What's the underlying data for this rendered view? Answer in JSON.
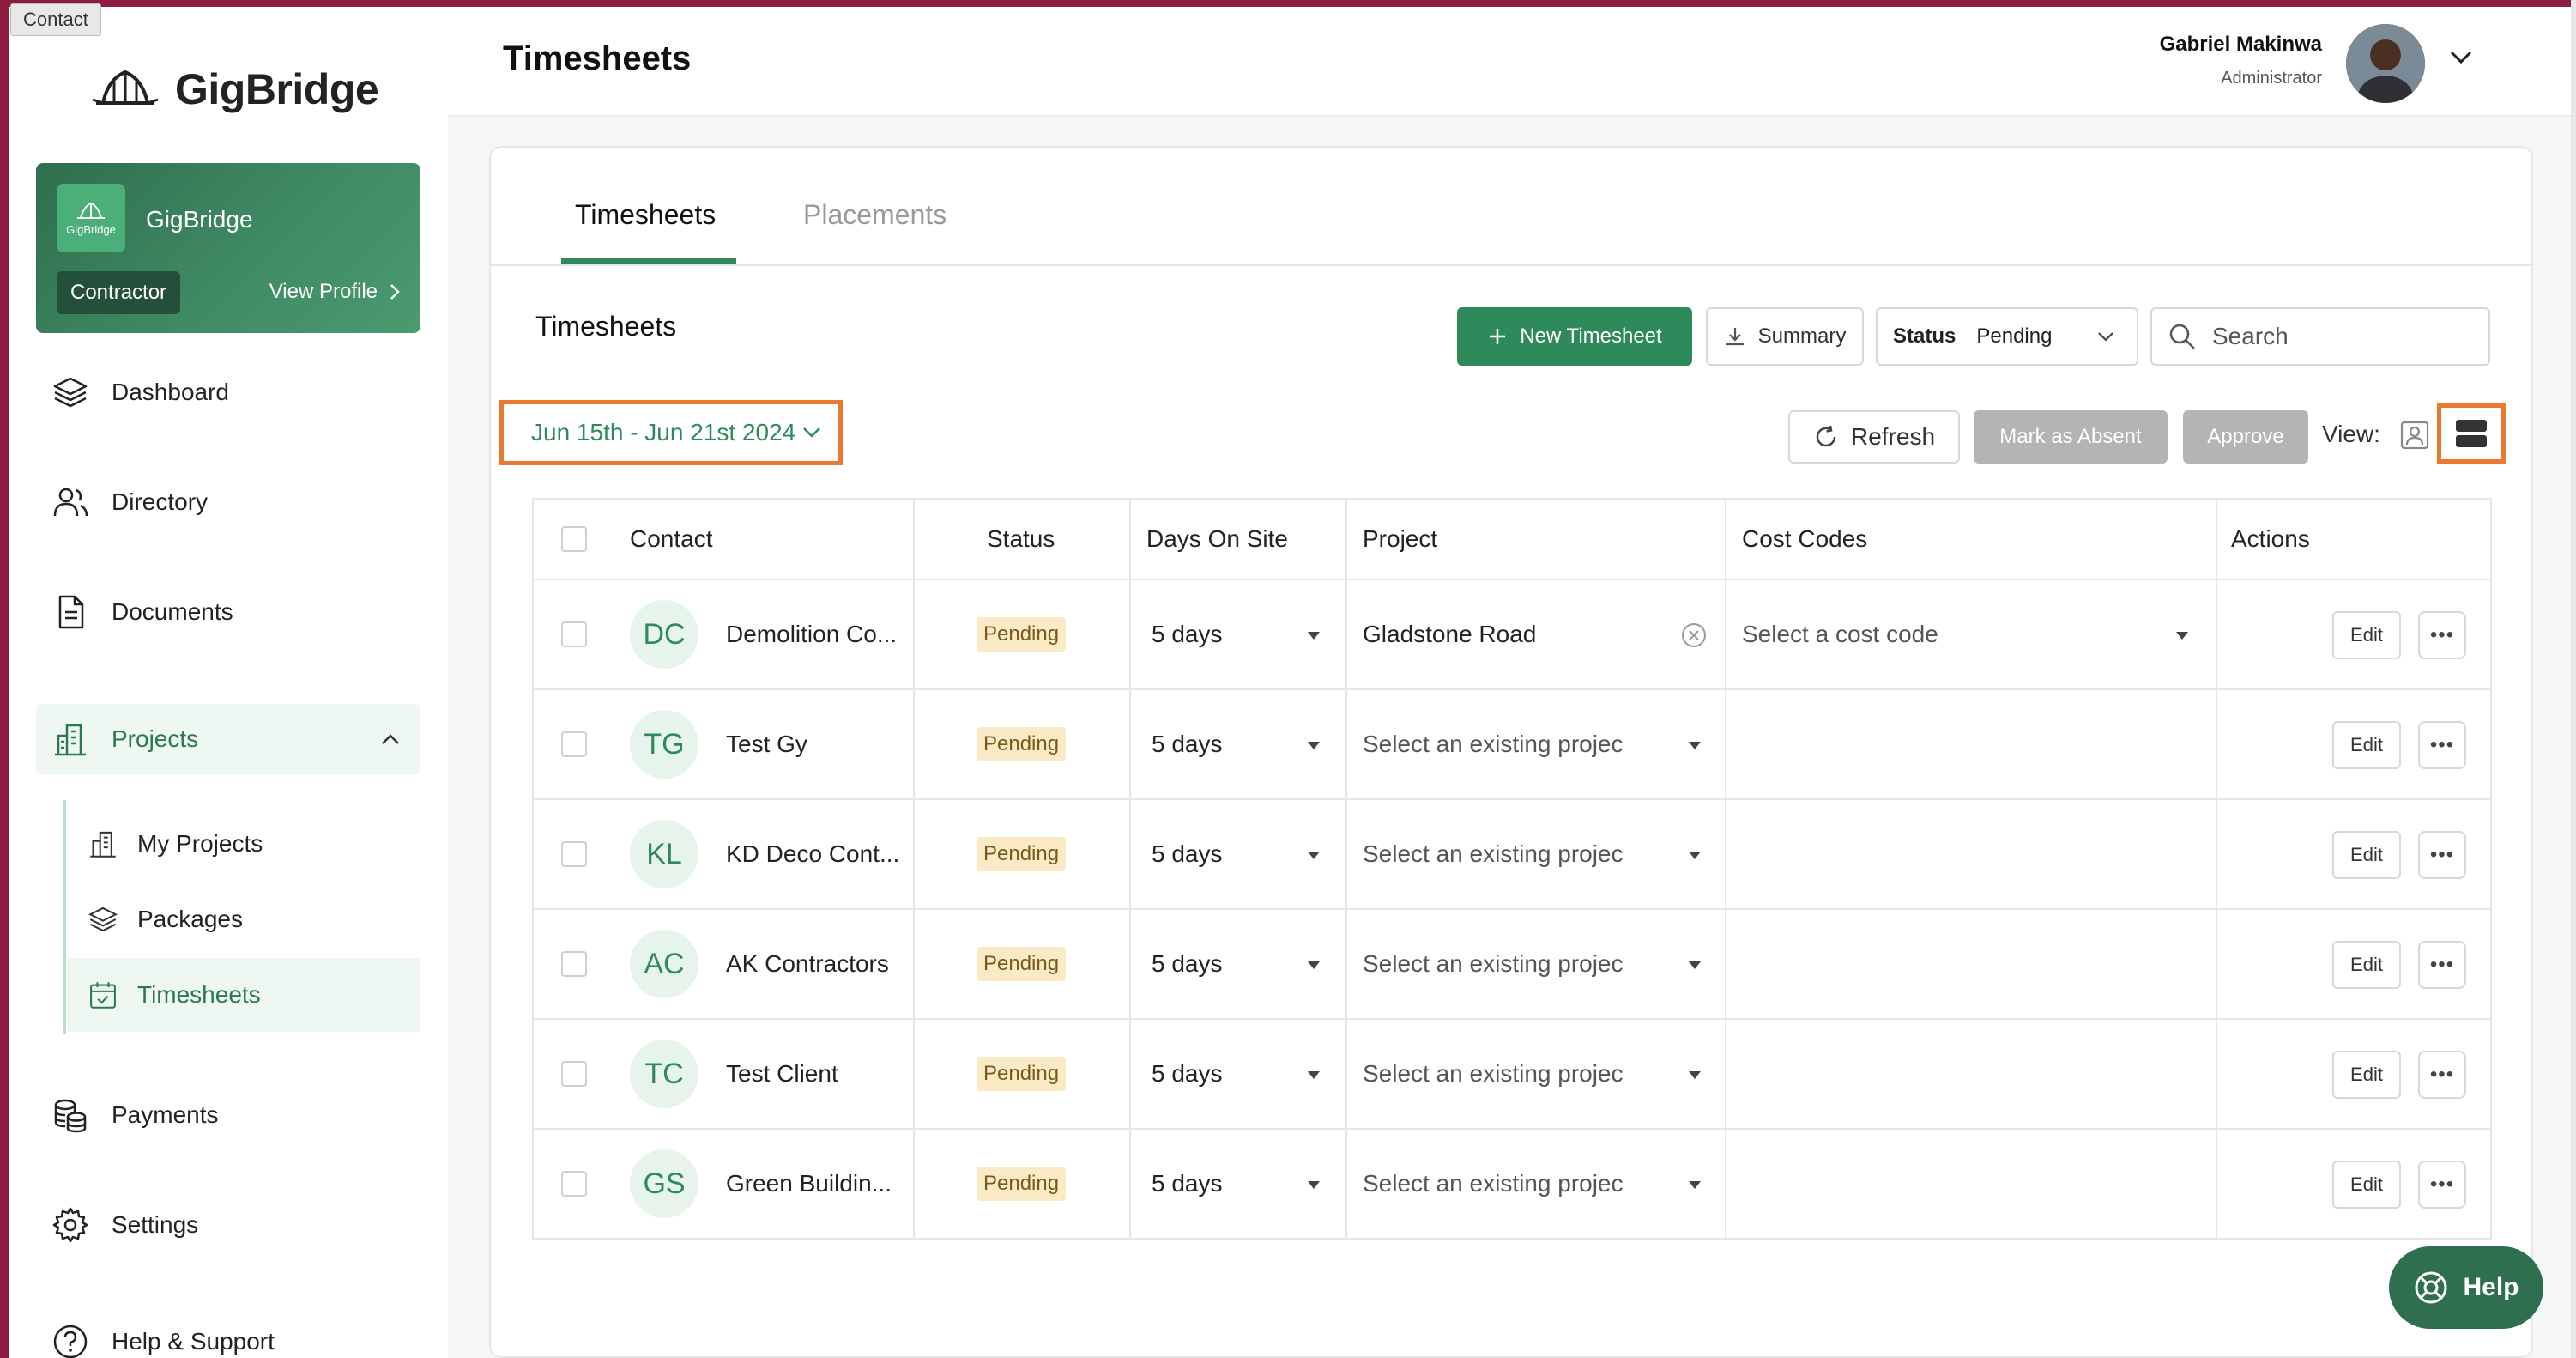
{
  "tooltip": "Contact",
  "brand": {
    "name": "GigBridge"
  },
  "org_card": {
    "logo_text": "GigBridge",
    "name": "GigBridge",
    "role": "Contractor",
    "view_profile": "View Profile"
  },
  "nav": {
    "dashboard": "Dashboard",
    "directory": "Directory",
    "documents": "Documents",
    "projects": "Projects",
    "my_projects": "My Projects",
    "packages": "Packages",
    "timesheets": "Timesheets",
    "payments": "Payments",
    "settings": "Settings",
    "help_support": "Help & Support"
  },
  "header": {
    "title": "Timesheets",
    "user_name": "Gabriel Makinwa",
    "user_role": "Administrator"
  },
  "tabs": [
    {
      "label": "Timesheets"
    },
    {
      "label": "Placements"
    }
  ],
  "section_title": "Timesheets",
  "toolbar": {
    "new_timesheet": "New Timesheet",
    "summary": "Summary",
    "status_label": "Status",
    "status_value": "Pending",
    "search_placeholder": "Search",
    "date_range": "Jun 15th - Jun 21st 2024",
    "refresh": "Refresh",
    "mark_absent": "Mark as Absent",
    "approve": "Approve",
    "view_label": "View:"
  },
  "table": {
    "columns": [
      "Contact",
      "Status",
      "Days On Site",
      "Project",
      "Cost Codes",
      "Actions"
    ],
    "rows": [
      {
        "initials": "DC",
        "contact": "Demolition Co...",
        "status": "Pending",
        "days": "5 days",
        "project": "Gladstone Road",
        "cost_code": "Select a cost code",
        "edit": "Edit",
        "more": "•••"
      },
      {
        "initials": "TG",
        "contact": "Test Gy",
        "status": "Pending",
        "days": "5 days",
        "project": "Select an existing projec",
        "cost_code": "",
        "edit": "Edit",
        "more": "•••"
      },
      {
        "initials": "KL",
        "contact": "KD Deco Cont...",
        "status": "Pending",
        "days": "5 days",
        "project": "Select an existing projec",
        "cost_code": "",
        "edit": "Edit",
        "more": "•••"
      },
      {
        "initials": "AC",
        "contact": "AK Contractors",
        "status": "Pending",
        "days": "5 days",
        "project": "Select an existing projec",
        "cost_code": "",
        "edit": "Edit",
        "more": "•••"
      },
      {
        "initials": "TC",
        "contact": "Test Client",
        "status": "Pending",
        "days": "5 days",
        "project": "Select an existing projec",
        "cost_code": "",
        "edit": "Edit",
        "more": "•••"
      },
      {
        "initials": "GS",
        "contact": "Green Buildin...",
        "status": "Pending",
        "days": "5 days",
        "project": "Select an existing projec",
        "cost_code": "",
        "edit": "Edit",
        "more": "•••"
      }
    ]
  },
  "help_button": "Help",
  "colors": {
    "accent": "#2f8a5b",
    "highlight": "#ea7a31",
    "pending_bg": "#faebc6",
    "frame": "#8c1d3f"
  }
}
